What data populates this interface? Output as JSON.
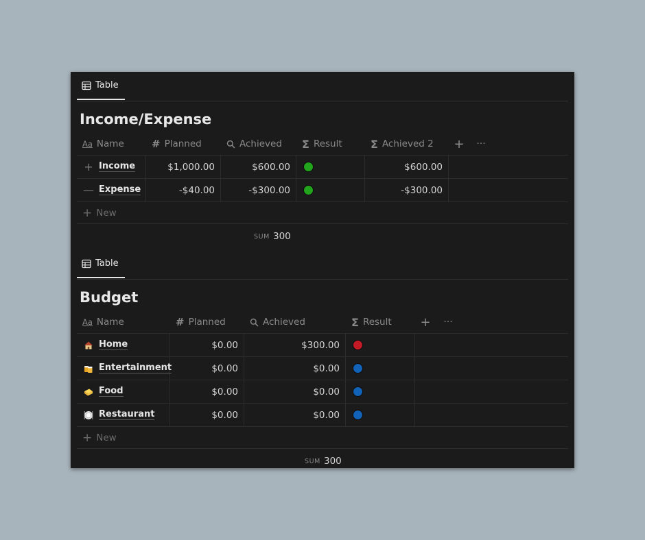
{
  "colors": {
    "background": "#a8b4bc",
    "panel": "#1b1b1b",
    "green_status": "#22a51c",
    "red_status": "#c41a26",
    "blue_status": "#1263b8"
  },
  "income_expense": {
    "tab_label": "Table",
    "title": "Income/Expense",
    "columns": {
      "name": "Name",
      "planned": "Planned",
      "achieved": "Achieved",
      "result": "Result",
      "achieved2": "Achieved 2"
    },
    "rows": [
      {
        "sign": "+",
        "name": "Income",
        "planned": "$1,000.00",
        "achieved": "$600.00",
        "result": "green",
        "achieved2": "$600.00"
      },
      {
        "sign": "—",
        "name": "Expense",
        "planned": "-$40.00",
        "achieved": "-$300.00",
        "result": "green",
        "achieved2": "-$300.00"
      }
    ],
    "new_label": "New",
    "sum_label": "SUM",
    "sum_value": "300"
  },
  "budget": {
    "tab_label": "Table",
    "title": "Budget",
    "columns": {
      "name": "Name",
      "planned": "Planned",
      "achieved": "Achieved",
      "result": "Result"
    },
    "rows": [
      {
        "icon": "house-icon",
        "name": "Home",
        "planned": "$0.00",
        "achieved": "$300.00",
        "result": "red"
      },
      {
        "icon": "beer-icon",
        "name": "Entertainment",
        "planned": "$0.00",
        "achieved": "$0.00",
        "result": "blue"
      },
      {
        "icon": "cheese-icon",
        "name": "Food",
        "planned": "$0.00",
        "achieved": "$0.00",
        "result": "blue"
      },
      {
        "icon": "restaurant-icon",
        "name": "Restaurant",
        "planned": "$0.00",
        "achieved": "$0.00",
        "result": "blue"
      }
    ],
    "new_label": "New",
    "sum_label": "SUM",
    "sum_value": "300"
  }
}
